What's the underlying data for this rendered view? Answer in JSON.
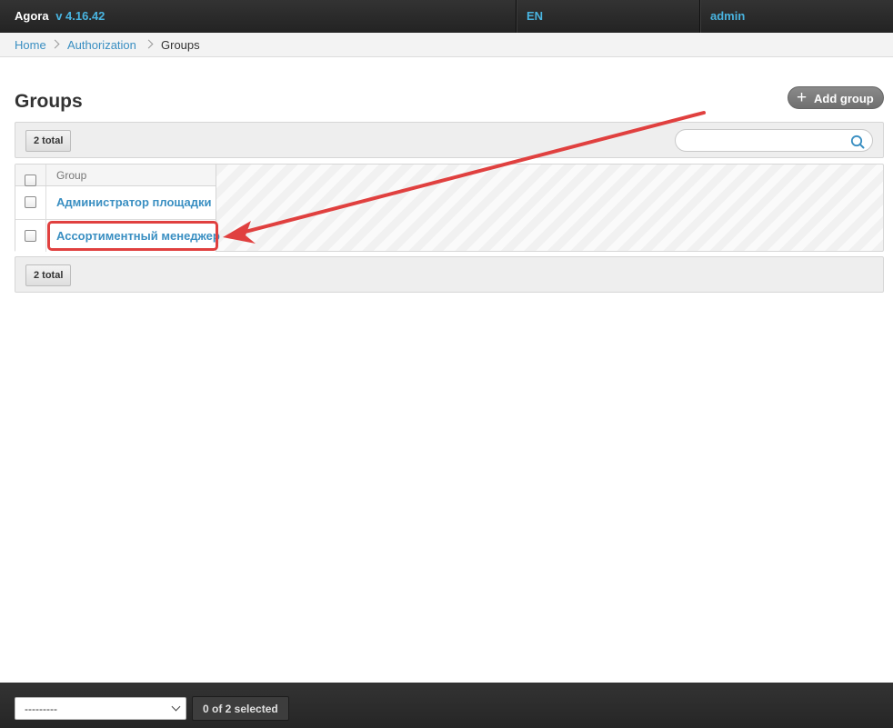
{
  "app": {
    "name": "Agora",
    "version": "v 4.16.42"
  },
  "topbar": {
    "language": "EN",
    "user": "admin"
  },
  "breadcrumbs": [
    {
      "label": "Home"
    },
    {
      "label": "Authorization"
    },
    {
      "label": "Groups"
    }
  ],
  "page": {
    "title": "Groups",
    "add_button": "Add group"
  },
  "toolbar_top": {
    "total": "2 total",
    "search_placeholder": ""
  },
  "table": {
    "columns": [
      "Group"
    ],
    "rows": [
      {
        "name": "Администратор площадки"
      },
      {
        "name": "Ассортиментный менеджер"
      }
    ]
  },
  "toolbar_bottom": {
    "total": "2 total"
  },
  "actions": {
    "select_value": "---------",
    "selected_count": "0 of 2 selected"
  },
  "colors": {
    "link": "#3a8fc2",
    "accent": "#49b4e0",
    "annotation": "#e0403f"
  }
}
